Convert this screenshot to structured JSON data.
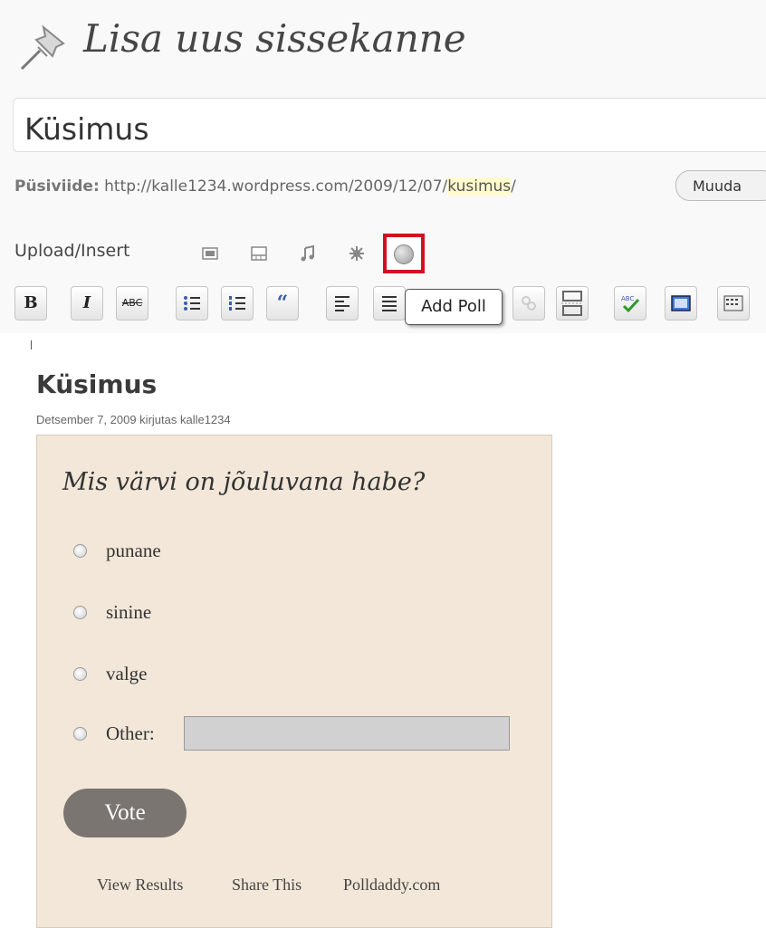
{
  "editor": {
    "page_title": "Lisa uus sissekanne",
    "post_title_value": "Küsimus",
    "permalink_label": "Püsiviide:",
    "permalink_url_prefix": "http://kalle1234.wordpress.com/2009/12/07/",
    "permalink_slug": "kusimus",
    "permalink_url_suffix": "/",
    "edit_permalink_button": "Muuda",
    "upload_insert_label": "Upload/Insert",
    "media_icons": [
      "image-icon",
      "video-icon",
      "audio-icon",
      "media-icon",
      "poll-icon"
    ],
    "toolbar": {
      "bold": "B",
      "italic": "I",
      "strike": "ABC",
      "tooltip": "Add Poll"
    },
    "highlight_color": "#d01020"
  },
  "post": {
    "title": "Küsimus",
    "meta": "Detsember 7, 2009 kirjutas kalle1234"
  },
  "poll": {
    "question": "Mis värvi on jõuluvana habe?",
    "options": [
      "punane",
      "sinine",
      "valge"
    ],
    "other_label": "Other:",
    "other_value": "",
    "vote_button": "Vote",
    "links": [
      "View Results",
      "Share This",
      "Polldaddy.com"
    ],
    "background_color": "#f2e7d8"
  }
}
